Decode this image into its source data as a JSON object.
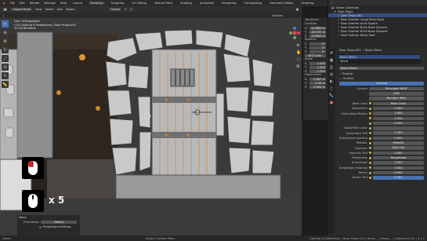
{
  "menubar": {
    "menus": [
      "File",
      "Edit",
      "Render",
      "Window",
      "Help"
    ],
    "workspaces": [
      "Layout",
      "Modeling",
      "Sculpting",
      "UV Editing",
      "Texture Paint",
      "Shading",
      "Animation",
      "Rendering",
      "Compositing",
      "Geometry Nodes",
      "Scripting"
    ],
    "active_workspace": "Modeling",
    "scene": "Scene",
    "view_layer": "ViewLayer"
  },
  "viewport_header": {
    "mode": "Object Mode",
    "view": "View",
    "select": "Select",
    "add": "Add",
    "object": "Object",
    "orientation": "Global"
  },
  "viewport_header2": {
    "transform_label": "Options"
  },
  "overlay": {
    "line1": "User Orthographic",
    "line2": "(73) Lighting & Reflections | Door Props.001",
    "line3": "10 Centimeters"
  },
  "transform": {
    "header": "Transform",
    "location_label": "Location",
    "location": [
      "-0.0869 m",
      "-53.937 m",
      "-0.0864 m"
    ],
    "rotation_label": "Rotation",
    "rotation": [
      "0°",
      "0°",
      "0°"
    ],
    "mode": "XYZ Euler",
    "scale_label": "Scale",
    "scale": [
      "1.000",
      "1.000",
      "1.000"
    ],
    "dimensions_label": "Dimensions",
    "dimensions": [
      "0.987 m",
      "0.34 m",
      "0.982 m"
    ]
  },
  "outliner": {
    "title": "Scene Collection",
    "items": [
      {
        "label": "Scene Collection",
        "selected": false
      },
      {
        "label": "Door Props",
        "selected": false
      },
      {
        "label": "Door Props.001",
        "selected": true
      },
      {
        "label": "Door Exterior Large Brick Base",
        "selected": false
      },
      {
        "label": "Door Exterior Arch Square",
        "selected": false
      },
      {
        "label": "Door Exterior Brick Base Squares",
        "selected": false
      },
      {
        "label": "Door Exterior Brick Base Squares",
        "selected": false
      },
      {
        "label": "Door Exterior Block Roof",
        "selected": false
      }
    ]
  },
  "properties": {
    "object_name": "Door Props.001",
    "material_slot": "Black Metal",
    "slots": [
      "Black Metal",
      "Wood"
    ],
    "material": "Black Metal",
    "sections": [
      "Preview",
      "Surface"
    ],
    "surface_label": "Surface",
    "surface_value": "Principled BSDF",
    "distribution": "GGX",
    "subsurface_method": "Random Walk",
    "rows": [
      {
        "label": "Base Color",
        "value": "Base Color",
        "blue": false
      },
      {
        "label": "Subsurface",
        "value": "0.000",
        "blue": false
      },
      {
        "label": "Subsurface Radius",
        "value": "1.000",
        "blue": false
      },
      {
        "label": "",
        "value": "0.200",
        "blue": false
      },
      {
        "label": "",
        "value": "0.100",
        "blue": false
      },
      {
        "label": "Subsurface Color",
        "value": "",
        "blue": false
      },
      {
        "label": "Subsurface IOR",
        "value": "1.400",
        "blue": false
      },
      {
        "label": "Subsurface Anisotropy",
        "value": "0.000",
        "blue": false
      },
      {
        "label": "Metallic",
        "value": "Metallic",
        "blue": false
      },
      {
        "label": "Specular",
        "value": "Specular",
        "blue": false
      },
      {
        "label": "Specular Tint",
        "value": "0.000",
        "blue": false
      },
      {
        "label": "Roughness",
        "value": "Roughness",
        "blue": false
      },
      {
        "label": "Anisotropic",
        "value": "0.000",
        "blue": false
      },
      {
        "label": "Anisotropic Rotation",
        "value": "0.000",
        "blue": false
      },
      {
        "label": "Sheen",
        "value": "0.000",
        "blue": false
      },
      {
        "label": "Sheen Tint",
        "value": "0.500",
        "blue": true
      }
    ]
  },
  "operator_panel": {
    "title": "Move",
    "orientation_label": "Orientation",
    "orientation_value": "Global",
    "proportional": "Proportional Editing"
  },
  "key_overlay": {
    "multiplier": "x 5"
  },
  "statusbar": {
    "left": "Select",
    "middle": "Object Context Menu",
    "right": "Lighting & Reflections | Door Props.001 | Verts:... | Faces:... | Objects:1/154 | 3.1.0"
  },
  "colors": {
    "accent": "#4772b3",
    "background": "#1d1d1d",
    "panel": "#2b2b2b"
  }
}
